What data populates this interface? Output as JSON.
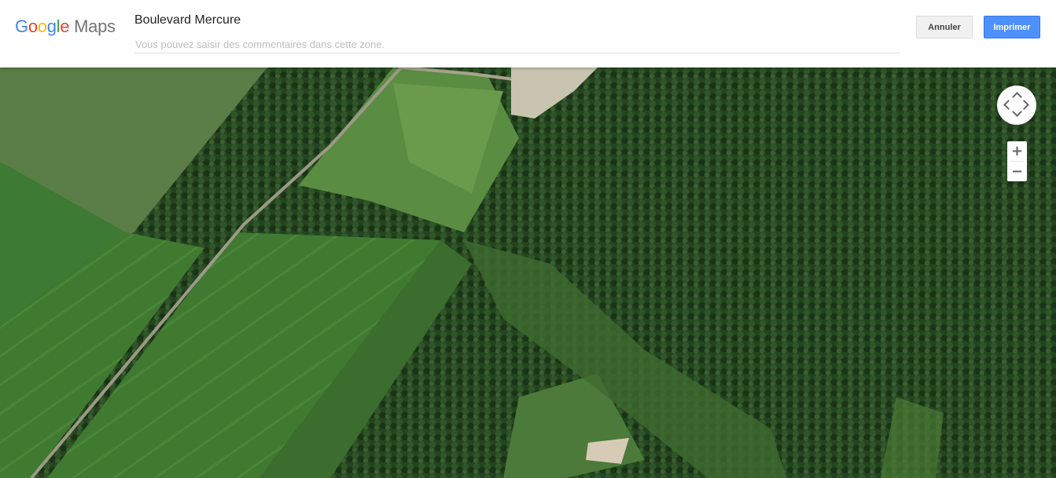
{
  "header": {
    "logo_text": "Google",
    "logo_suffix": "Maps",
    "title": "Boulevard Mercure",
    "comment_placeholder": "Vous pouvez saisir des commentaires dans cette zone.",
    "cancel_label": "Annuler",
    "print_label": "Imprimer"
  },
  "map": {
    "view": "satellite",
    "zoom_in_label": "+",
    "zoom_out_label": "−",
    "icons": [
      "pan-control-icon",
      "zoom-in-icon",
      "zoom-out-icon"
    ]
  },
  "colors": {
    "print_button": "#4d90fe",
    "field_light": "#4a8a3a",
    "forest_dark": "#1f3d1c"
  }
}
